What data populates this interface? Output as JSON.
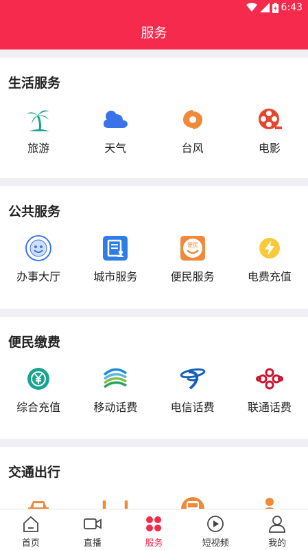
{
  "status": {
    "time": "6:43"
  },
  "header": {
    "title": "服务"
  },
  "sections": [
    {
      "title": "生活服务",
      "items": [
        {
          "label": "旅游",
          "icon": "palm-tree-icon"
        },
        {
          "label": "天气",
          "icon": "cloud-icon"
        },
        {
          "label": "台风",
          "icon": "typhoon-icon"
        },
        {
          "label": "电影",
          "icon": "film-reel-icon"
        }
      ]
    },
    {
      "title": "公共服务",
      "items": [
        {
          "label": "办事大厅",
          "icon": "government-seal-icon"
        },
        {
          "label": "城市服务",
          "icon": "city-service-icon"
        },
        {
          "label": "便民服务",
          "icon": "bianmin-face-icon"
        },
        {
          "label": "电费充值",
          "icon": "lightning-icon"
        }
      ]
    },
    {
      "title": "便民缴费",
      "items": [
        {
          "label": "综合充值",
          "icon": "yuan-recharge-icon"
        },
        {
          "label": "移动话费",
          "icon": "china-mobile-logo-icon"
        },
        {
          "label": "电信话费",
          "icon": "china-telecom-logo-icon"
        },
        {
          "label": "联通话费",
          "icon": "china-unicom-logo-icon"
        }
      ]
    },
    {
      "title": "交通出行",
      "items": [
        {
          "label": "",
          "icon": "car-icon"
        },
        {
          "label": "",
          "icon": "didi-icon"
        },
        {
          "label": "",
          "icon": "bus-icon"
        },
        {
          "label": "",
          "icon": "driver-icon"
        }
      ]
    }
  ],
  "tabs": [
    {
      "label": "首页",
      "icon": "home-icon"
    },
    {
      "label": "直播",
      "icon": "video-camera-icon"
    },
    {
      "label": "服务",
      "icon": "four-dots-icon",
      "active": true
    },
    {
      "label": "短视频",
      "icon": "play-circle-icon"
    },
    {
      "label": "我的",
      "icon": "user-icon"
    }
  ],
  "colors": {
    "primary": "#f62a4c",
    "teal": "#1aa48e",
    "blue": "#3a73e8",
    "orange": "#f0893a",
    "red": "#e8452c"
  }
}
